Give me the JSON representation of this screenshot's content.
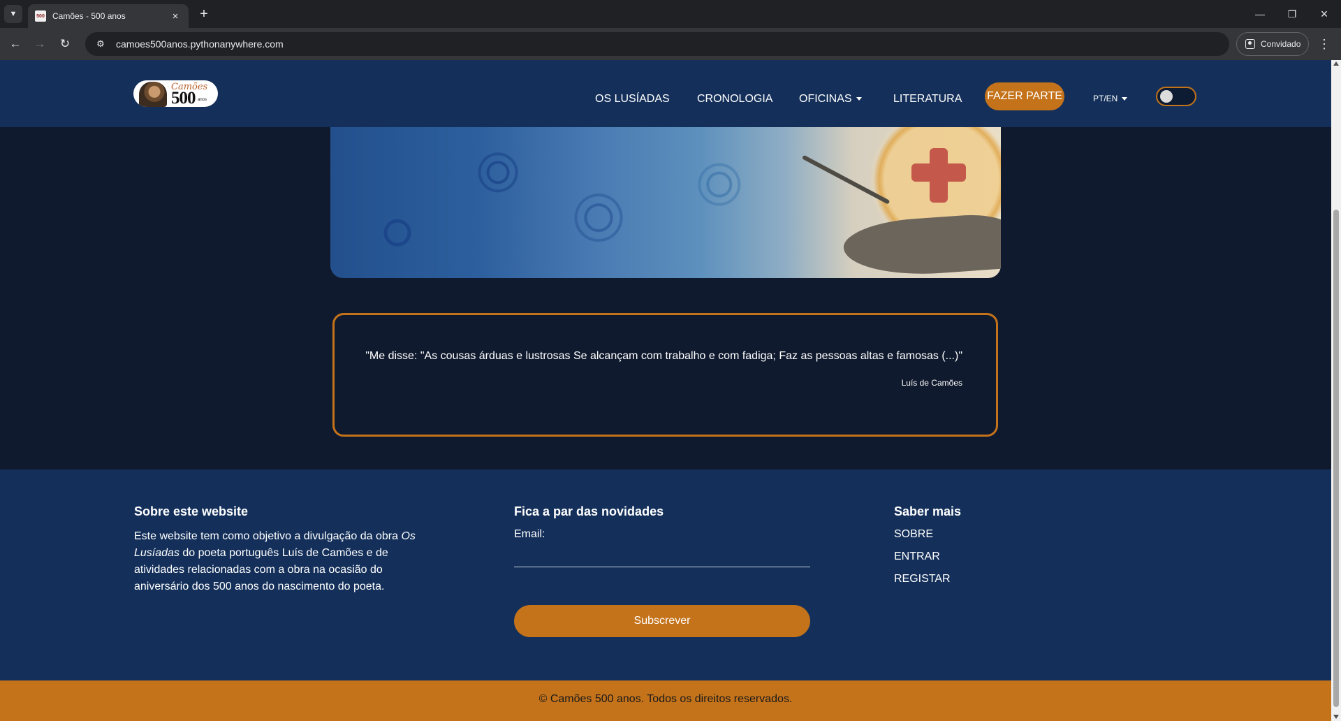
{
  "browser": {
    "tab_title": "Camões - 500 anos",
    "favicon_text": "500",
    "url": "camoes500anos.pythonanywhere.com",
    "profile_label": "Convidado"
  },
  "site_nav": {
    "logo": {
      "camoes": "Camões",
      "number": "500",
      "anos": "anos"
    },
    "links": {
      "lusiadas": "OS LUSÍADAS",
      "cronologia": "CRONOLOGIA",
      "oficinas": "OFICINAS",
      "literatura": "LITERATURA"
    },
    "cta": "FAZER PARTE",
    "language": "PT/EN",
    "theme_toggle_on": false
  },
  "quote": {
    "text": "\"Me disse: \"As cousas árduas e lustrosas Se alcançam com trabalho e com fadiga; Faz as pessoas altas e famosas (...)\"",
    "author": "Luís de Camões"
  },
  "footer": {
    "about": {
      "heading": "Sobre este website",
      "text_before": "Este website tem como objetivo a divulgação da obra ",
      "work_title": "Os Lusíadas",
      "text_after": " do poeta português Luís de Camões e de atividades relacionadas com a obra na ocasião do aniversário dos 500 anos do nascimento do poeta."
    },
    "newsletter": {
      "heading": "Fica a par das novidades",
      "email_label": "Email:",
      "email_value": "",
      "subscribe_label": "Subscrever"
    },
    "more": {
      "heading": "Saber mais",
      "links": {
        "sobre": "SOBRE",
        "entrar": "ENTRAR",
        "registar": "REGISTAR"
      }
    },
    "copyright": "© Camões 500 anos. Todos os direitos reservados."
  },
  "colors": {
    "nav_background": "#14305a",
    "page_background": "#101a2e",
    "accent": "#c4731b"
  }
}
